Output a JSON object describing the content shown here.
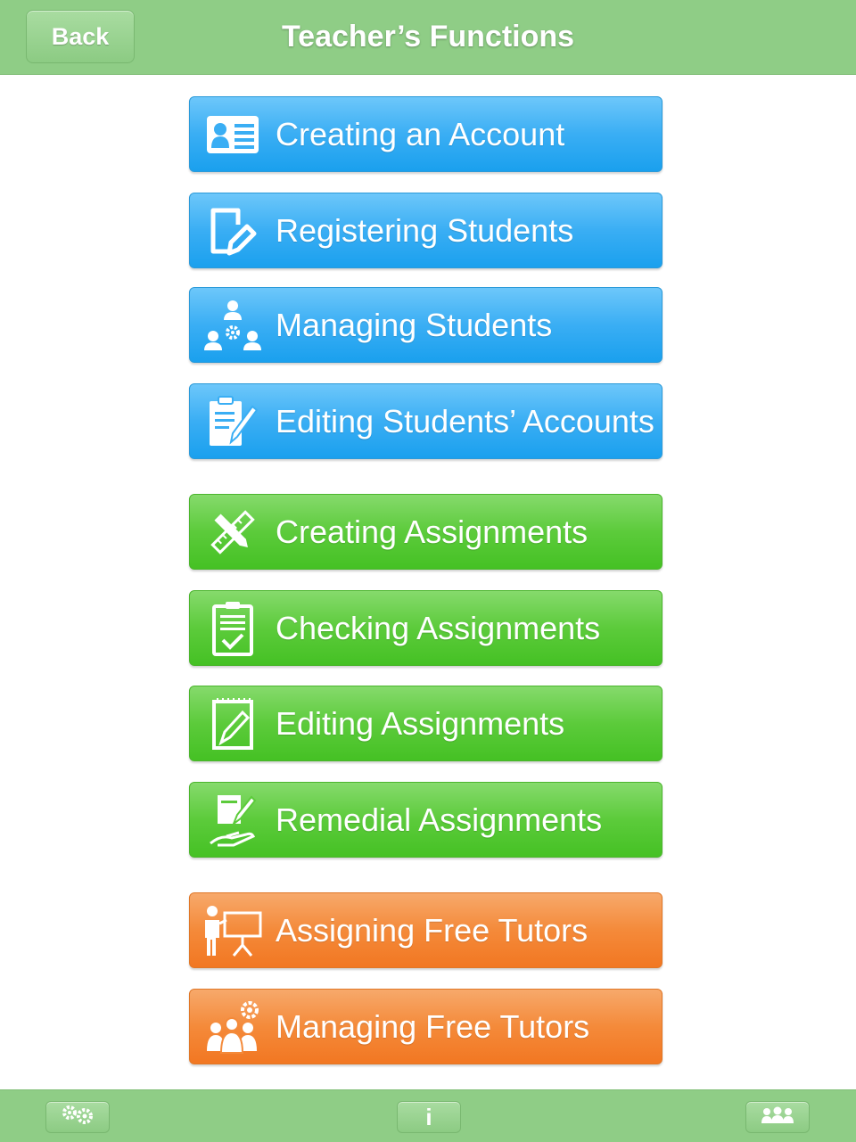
{
  "header": {
    "back_label": "Back",
    "title": "Teacher’s Functions"
  },
  "menu": [
    {
      "label": "Creating an Account",
      "group": "account",
      "icon": "id-card-icon"
    },
    {
      "label": "Registering Students",
      "group": "account",
      "icon": "edit-document-icon"
    },
    {
      "label": "Managing Students",
      "group": "account",
      "icon": "people-gear-icon"
    },
    {
      "label": "Editing Students’ Accounts",
      "group": "account",
      "icon": "clipboard-pencil-icon"
    },
    {
      "label": "Creating Assignments",
      "group": "assignments",
      "icon": "ruler-pencil-icon"
    },
    {
      "label": "Checking Assignments",
      "group": "assignments",
      "icon": "clipboard-check-icon"
    },
    {
      "label": "Editing Assignments",
      "group": "assignments",
      "icon": "notepad-pen-icon"
    },
    {
      "label": "Remedial Assignments",
      "group": "assignments",
      "icon": "hand-document-icon"
    },
    {
      "label": "Assigning Free Tutors",
      "group": "tutors",
      "icon": "presenter-board-icon"
    },
    {
      "label": "Managing Free Tutors",
      "group": "tutors",
      "icon": "group-gear-icon"
    }
  ],
  "footer": {
    "info_label": "i",
    "settings_icon": "gears-icon",
    "users_icon": "users-icon"
  },
  "colors": {
    "bar_green": "#8fcd86",
    "account_blue": "#3aaef4",
    "assignments_green": "#5ccb3b",
    "tutors_orange": "#f48a3a"
  }
}
